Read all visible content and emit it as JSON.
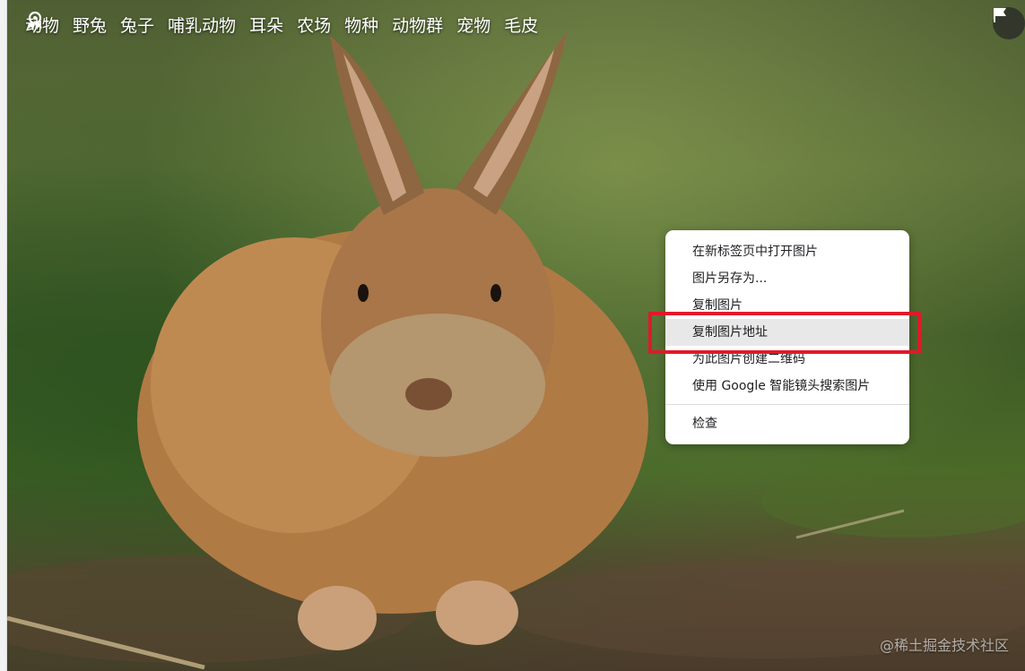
{
  "tags_bar": {
    "logo_icon": "google-lens-icon",
    "tags": [
      "动物",
      "野兔",
      "兔子",
      "哺乳动物",
      "耳朵",
      "农场",
      "物种",
      "动物群",
      "宠物",
      "毛皮"
    ]
  },
  "flag_icon": "flag-icon",
  "context_menu": {
    "items": [
      "在新标签页中打开图片",
      "图片另存为...",
      "复制图片",
      "复制图片地址",
      "为此图片创建二维码",
      "使用 Google 智能镜头搜索图片",
      "检查"
    ],
    "active_item": "复制图片地址"
  },
  "highlight_color": "#e0192a",
  "watermark": "@稀土掘金技术社区"
}
